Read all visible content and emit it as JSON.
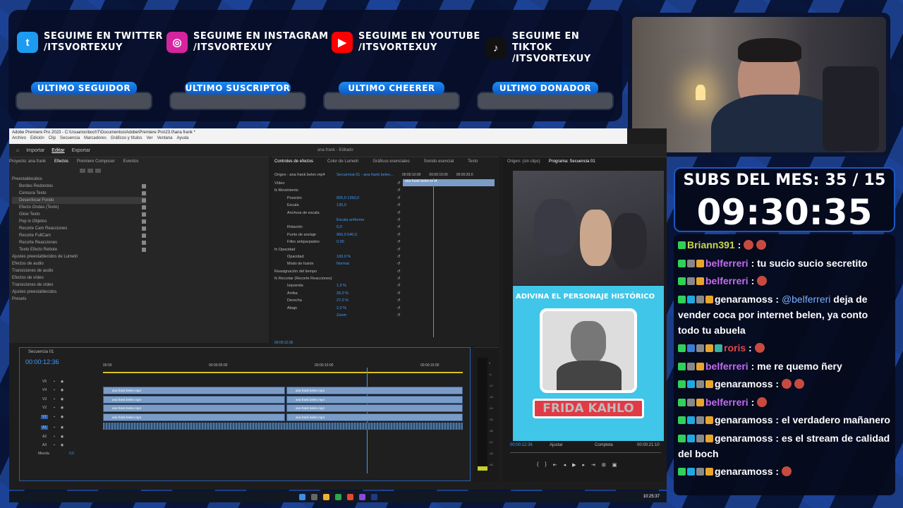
{
  "social": [
    {
      "icon": "twitter-icon",
      "color": "#1d9bf0",
      "glyph": "t",
      "line1": "SEGUIME EN TWITTER",
      "line2": "/ITSVORTEXUY"
    },
    {
      "icon": "instagram-icon",
      "color": "#d6249f",
      "glyph": "◎",
      "line1": "SEGUIME EN INSTAGRAM",
      "line2": "/ITSVORTEXUY"
    },
    {
      "icon": "youtube-icon",
      "color": "#ff0000",
      "glyph": "▶",
      "line1": "SEGUIME EN YOUTUBE",
      "line2": "/ITSVORTEXUY"
    },
    {
      "icon": "tiktok-icon",
      "color": "#111111",
      "glyph": "♪",
      "line1": "SEGUIME EN TIKTOK",
      "line2": "/ITSVORTEXUY"
    }
  ],
  "last_labels": [
    "ULTIMO SEGUIDOR",
    "ULTIMO SUSCRIPTOR",
    "ULTIMO CHEERER",
    "ULTIMO DONADOR"
  ],
  "subs": {
    "title": "SUBS DEL MES: 35 / 15",
    "timer": "09:30:35"
  },
  "chat": [
    {
      "badges": [
        "#2fd158"
      ],
      "user": "Briann391",
      "color": "#c8d84a",
      "text": " :",
      "emotes": 2
    },
    {
      "badges": [
        "#2fd158",
        "#888888",
        "#e8a52b"
      ],
      "user": "belferreri",
      "color": "#c36bf0",
      "text": " : tu sucio sucio secretito",
      "emotes": 0
    },
    {
      "badges": [
        "#2fd158",
        "#888888",
        "#e8a52b"
      ],
      "user": "belferreri",
      "color": "#c36bf0",
      "text": " :",
      "emotes": 1
    },
    {
      "badges": [
        "#2fd158",
        "#1fa8e0",
        "#888888",
        "#e8a52b"
      ],
      "user": "genaramoss",
      "color": "#ffffff",
      "text": " : ",
      "mention": "@belferreri",
      "rest": " deja de vender coca por internet belen, ya conto todo tu abuela",
      "emotes": 0
    },
    {
      "badges": [
        "#2fd158",
        "#3a7bd5",
        "#888888",
        "#e8a52b",
        "#3ab0a0"
      ],
      "user": "roris",
      "color": "#e04848",
      "text": " :",
      "emotes": 1
    },
    {
      "badges": [
        "#2fd158",
        "#888888",
        "#e8a52b"
      ],
      "user": "belferreri",
      "color": "#c36bf0",
      "text": " : me re quemo ñery",
      "emotes": 0
    },
    {
      "badges": [
        "#2fd158",
        "#1fa8e0",
        "#888888",
        "#e8a52b"
      ],
      "user": "genaramoss",
      "color": "#ffffff",
      "text": " :",
      "emotes": 2
    },
    {
      "badges": [
        "#2fd158",
        "#888888",
        "#e8a52b"
      ],
      "user": "belferreri",
      "color": "#c36bf0",
      "text": " :",
      "emotes": 1
    },
    {
      "badges": [
        "#2fd158",
        "#1fa8e0",
        "#888888",
        "#e8a52b"
      ],
      "user": "genaramoss",
      "color": "#ffffff",
      "text": " : el verdadero mañanero",
      "emotes": 0
    },
    {
      "badges": [
        "#2fd158",
        "#1fa8e0",
        "#888888",
        "#e8a52b"
      ],
      "user": "genaramoss",
      "color": "#ffffff",
      "text": " : es el stream de calidad del boch",
      "emotes": 0
    },
    {
      "badges": [
        "#2fd158",
        "#1fa8e0",
        "#888888",
        "#e8a52b"
      ],
      "user": "genaramoss",
      "color": "#ffffff",
      "text": " :",
      "emotes": 1
    }
  ],
  "premiere": {
    "title": "Adobe Premiere Pro 2023 - C:\\Usuarios\\bochT\\Documentos\\Adobe\\Premiere Pro\\23.0\\ana frank *",
    "menu": [
      "Archivo",
      "Edición",
      "Clip",
      "Secuencia",
      "Marcadores",
      "Gráficos y títulos",
      "Ver",
      "Ventana",
      "Ayuda"
    ],
    "workspaces": [
      "Inicio",
      "Importar",
      "Editar",
      "Exportar"
    ],
    "doc_title": "ana frank - Editado",
    "left_tabs": [
      "Proyecto: ana frank",
      "Efectos",
      "Premiere Composer",
      "Eventos"
    ],
    "effects": [
      "Preestablecidos",
      "Bordes Redondos",
      "Censura Texto",
      "Desenfocar Fondo",
      "Efecto Ondas (Texto)",
      "Glow Texto",
      "Pop in Objetos",
      "Recorte Cam Reacciones",
      "Recorte FullCam",
      "Recorte Reacciones",
      "Texto Efecto Rebote",
      "Ajustes preestablecidos de Lumetri",
      "Efectos de audio",
      "Transiciones de audio",
      "Efectos de vídeo",
      "Transiciones de vídeo",
      "Ajustes preestablecidos",
      "Presets"
    ],
    "ec_tabs": [
      "Controles de efectos",
      "Color de Lumetri",
      "Gráficos esenciales",
      "Sonido esencial",
      "Texto"
    ],
    "ec_source": "Origen - ana frank belen.mp4",
    "ec_seq": "Secuencia 01 - ana frank belen...",
    "ec_rows": [
      [
        "Vídeo",
        ""
      ],
      [
        "fx Movimiento",
        ""
      ],
      [
        "Posición",
        "655,0   1250,0"
      ],
      [
        "Escala",
        "130,0"
      ],
      [
        "Anchura de escala",
        ""
      ],
      [
        "",
        "Escala uniforme"
      ],
      [
        "Rotación",
        "0,0"
      ],
      [
        "Punto de anclaje",
        "960,0   540,0"
      ],
      [
        "Filtro antiparpadeo",
        "0,00"
      ],
      [
        "fx Opacidad",
        ""
      ],
      [
        "Opacidad",
        "100,0 %"
      ],
      [
        "Modo de fusión",
        "Normal"
      ],
      [
        "Reasignación del tiempo",
        ""
      ],
      [
        "fx Recortar (Recorte Reacciones)",
        ""
      ],
      [
        "Izquierda",
        "1,0 %"
      ],
      [
        "Arriba",
        "26,0 %"
      ],
      [
        "Derecha",
        "27,0 %"
      ],
      [
        "Abajo",
        "2,0 %"
      ],
      [
        "",
        "Zoom"
      ]
    ],
    "ec_timecodes": [
      "00:00:10:00",
      "00:00:15:00",
      "00:00:20:0"
    ],
    "ec_clip": "ana frank belen.mp4",
    "ec_time": "00:00:12:36",
    "source_tab": "Origen: (sin clips)",
    "program_tab": "Programa: Secuencia 01",
    "seq_tab": "Secuencia 01",
    "seq_time": "00:00:12:36",
    "ruler": [
      "00:00",
      "00:00:05:00",
      "00:00:10:00",
      "00:00:15:00"
    ],
    "tracks": [
      "V5",
      "V4",
      "V3",
      "V2",
      "V1",
      "A1",
      "A2",
      "A3"
    ],
    "mix_label": "Mezcla",
    "mix_val": "0,0",
    "clip_name": "ana frank belen.mp4",
    "prog_time": "00:00:12:36",
    "prog_fit": "Ajustar",
    "prog_quality": "Completa",
    "prog_duration": "00:00:21:10",
    "video_top": "ADIVINA EL PERSONAJE HISTÓRICO",
    "video_name": "FRIDA KAHLO",
    "meter_labels": [
      "0",
      "-6",
      "-12",
      "-18",
      "-24",
      "-30",
      "-36",
      "-42",
      "-48",
      "-54"
    ],
    "clock": "10:25:37"
  },
  "colors": {
    "accent": "#1b57c2",
    "timecode": "#3f9bff",
    "bg": "#0b1a3a"
  }
}
